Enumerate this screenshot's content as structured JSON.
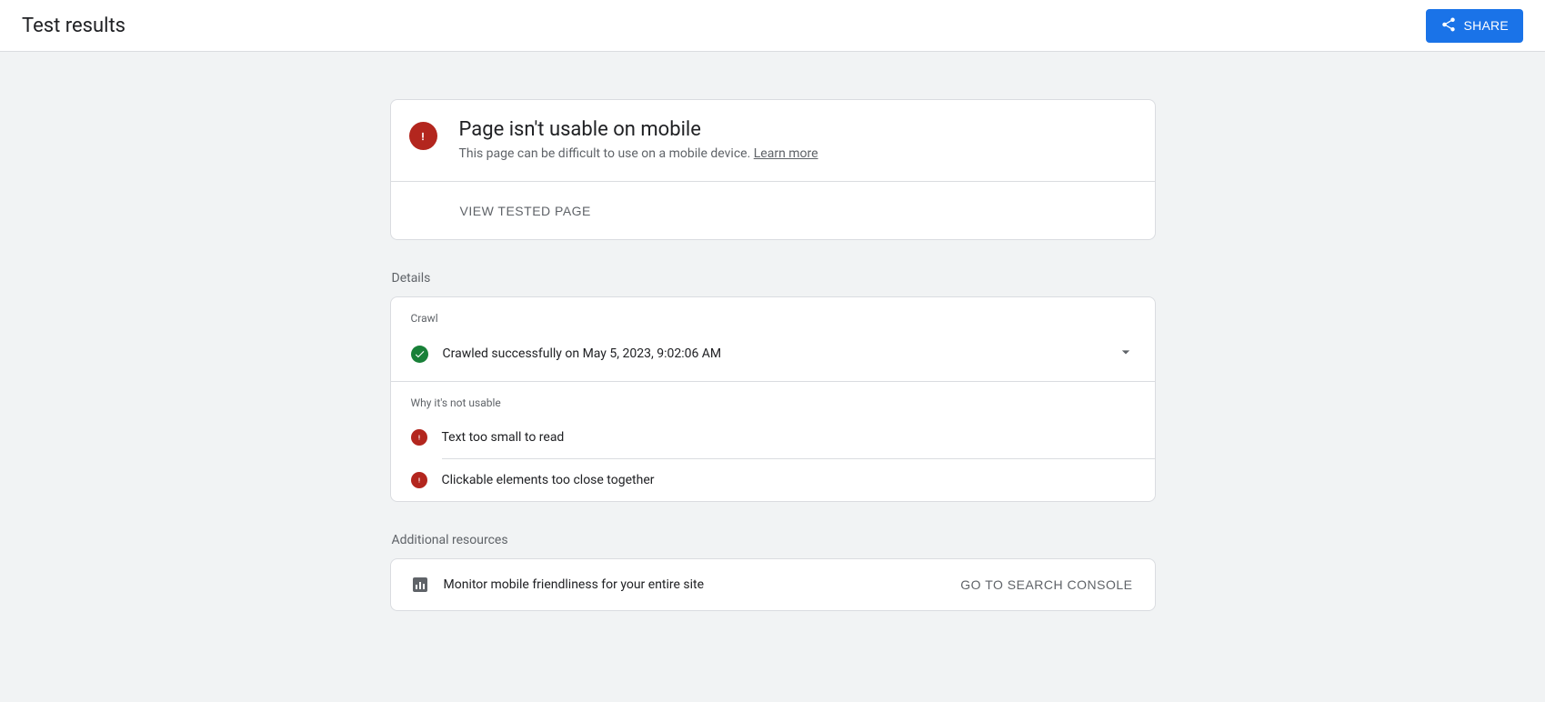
{
  "header": {
    "title": "Test results",
    "shareButton": "Share"
  },
  "status": {
    "title": "Page isn't usable on mobile",
    "subtitle": "This page can be difficult to use on a mobile device. ",
    "learnMore": "Learn more"
  },
  "viewTested": {
    "label": "View tested page"
  },
  "sections": {
    "details": "Details",
    "crawl": "Crawl",
    "whyNotUsable": "Why it's not usable",
    "additionalResources": "Additional resources"
  },
  "crawl": {
    "text": "Crawled successfully on May 5, 2023, 9:02:06 AM"
  },
  "issues": [
    {
      "text": "Text too small to read"
    },
    {
      "text": "Clickable elements too close together"
    }
  ],
  "resource": {
    "text": "Monitor mobile friendliness for your entire site",
    "button": "Go to Search Console"
  }
}
